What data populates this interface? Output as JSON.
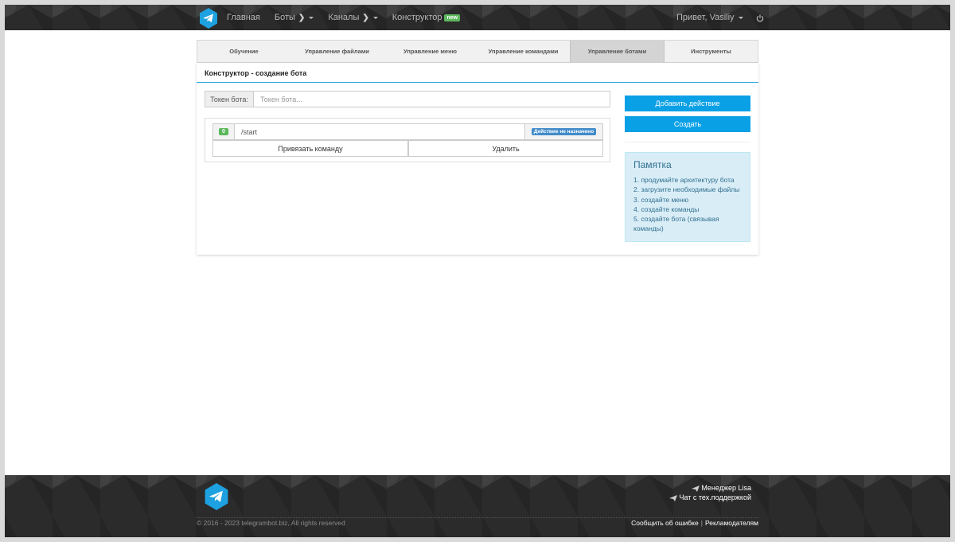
{
  "navbar": {
    "items": [
      {
        "label": "Главная"
      },
      {
        "label": "Боты"
      },
      {
        "label": "Каналы"
      },
      {
        "label": "Конструктор",
        "badge": "new"
      }
    ],
    "greeting": "Привет, Vasiliy"
  },
  "tabs": [
    {
      "label": "Обучение"
    },
    {
      "label": "Управление файлами"
    },
    {
      "label": "Управление меню"
    },
    {
      "label": "Управление командами"
    },
    {
      "label": "Управление ботами",
      "active": true
    },
    {
      "label": "Инструменты"
    }
  ],
  "panel": {
    "title": "Конструктор - создание бота",
    "token_label": "Токен бота:",
    "token_placeholder": "Токен бота...",
    "token_value": ""
  },
  "command": {
    "number": "0",
    "text": "/start",
    "status": "Действие не назначено",
    "bind_label": "Привязать команду",
    "delete_label": "Удалить"
  },
  "sidebar": {
    "add_action_label": "Добавить действие",
    "create_label": "Создать",
    "memo_title": "Памятка",
    "memo_items": [
      "1. продумайте архитектуру бота",
      "2. загрузите необходимые файлы",
      "3. создайте меню",
      "4. создайте команды",
      "5. создайте бота (связывая команды)"
    ]
  },
  "footer": {
    "manager_link": "Менеджер Lisa",
    "support_link": "Чат с тех.поддержкой",
    "copyright": "© 2016 - 2023 telegrambot.biz, All rights reserved",
    "report_link": "Сообщить об ошибке",
    "separator": "|",
    "ads_link": "Рекламодателям"
  },
  "colors": {
    "accent": "#0aa0e6",
    "header_bg": "#2b2b2b",
    "memo_bg": "#d9edf7",
    "memo_text": "#31708f",
    "badge_green": "#5cb85c",
    "status_blue": "#428bca"
  },
  "icons": {
    "logo": "telegram-logo-icon",
    "power": "power-icon",
    "plane": "paper-plane-icon"
  }
}
